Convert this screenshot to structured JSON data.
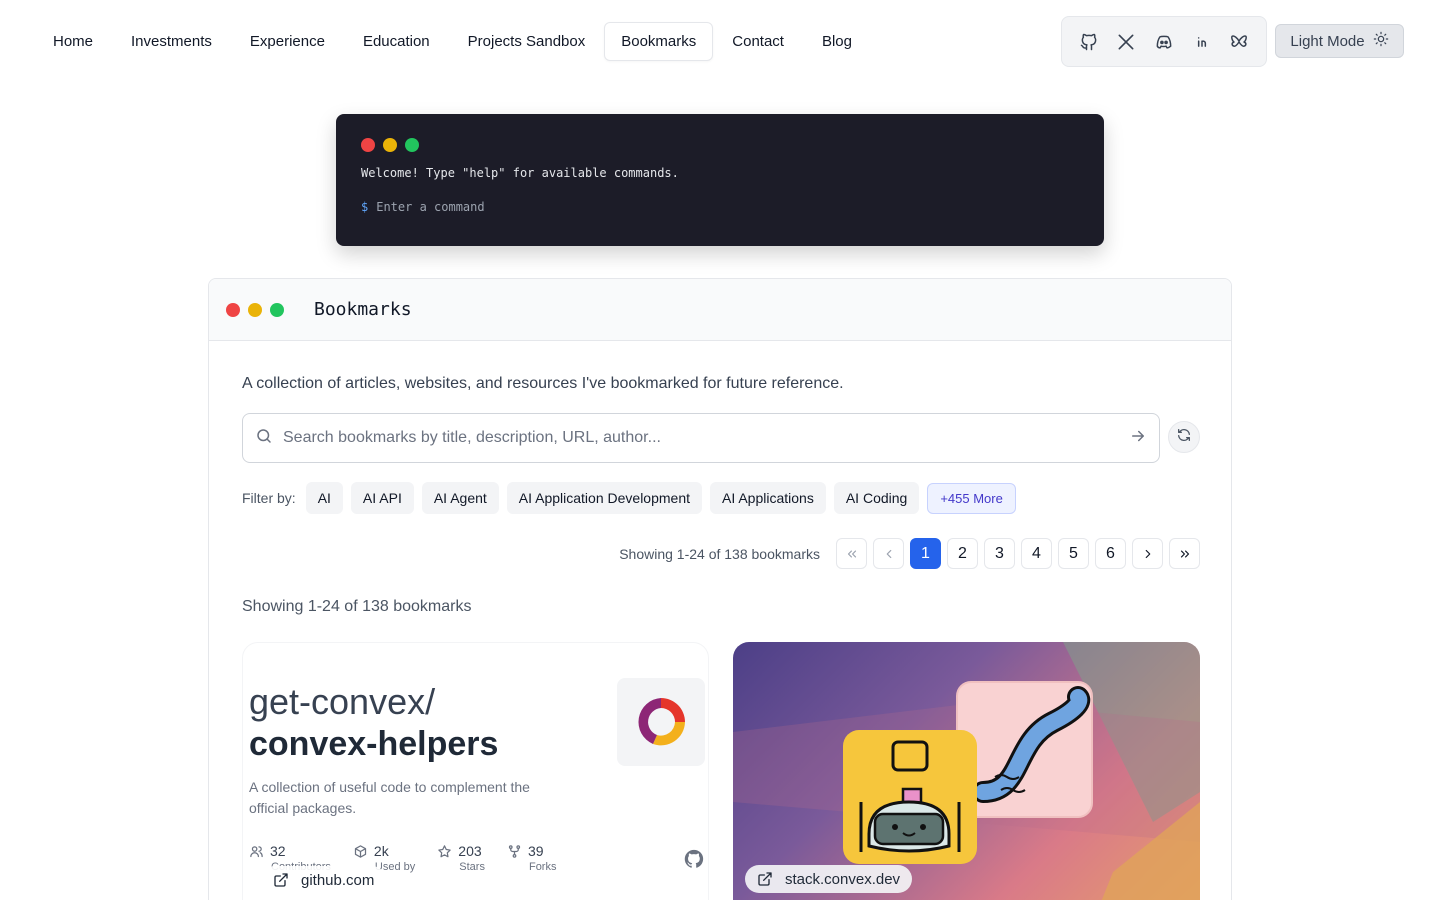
{
  "nav": {
    "items": [
      {
        "label": "Home",
        "name": "home"
      },
      {
        "label": "Investments",
        "name": "investments"
      },
      {
        "label": "Experience",
        "name": "experience"
      },
      {
        "label": "Education",
        "name": "education"
      },
      {
        "label": "Projects Sandbox",
        "name": "projects-sandbox"
      },
      {
        "label": "Bookmarks",
        "name": "bookmarks",
        "active": true
      },
      {
        "label": "Contact",
        "name": "contact"
      },
      {
        "label": "Blog",
        "name": "blog"
      }
    ],
    "social_icons": [
      "github-icon",
      "x-icon",
      "discord-icon",
      "linkedin-icon",
      "bluesky-icon"
    ],
    "theme_label": "Light Mode",
    "theme_icon": "sun-icon"
  },
  "terminal": {
    "welcome": "Welcome! Type \"help\" for available commands.",
    "prompt_symbol": "$",
    "placeholder": "Enter a command"
  },
  "panel": {
    "title": "Bookmarks",
    "description": "A collection of articles, websites, and resources I've bookmarked for future reference.",
    "search_placeholder": "Search bookmarks by title, description, URL, author...",
    "filter_label": "Filter by:",
    "filters": [
      "AI",
      "AI API",
      "AI Agent",
      "AI Application Development",
      "AI Applications",
      "AI Coding"
    ],
    "more_filters": "+455 More",
    "pagination": {
      "summary": "Showing 1-24 of 138 bookmarks",
      "pages": [
        "1",
        "2",
        "3",
        "4",
        "5",
        "6"
      ],
      "current_page": 1
    },
    "showing": "Showing 1-24 of 138 bookmarks"
  },
  "cards": [
    {
      "owner": "get-convex/",
      "repo": "convex-helpers",
      "description": "A collection of useful code to complement the official packages.",
      "stats": [
        {
          "value": "32",
          "label": "Contributors",
          "icon": "people-icon"
        },
        {
          "value": "2k",
          "label": "Used by",
          "icon": "package-icon"
        },
        {
          "value": "203",
          "label": "Stars",
          "icon": "star-icon"
        },
        {
          "value": "39",
          "label": "Forks",
          "icon": "fork-icon"
        }
      ],
      "domain": "github.com"
    },
    {
      "domain": "stack.convex.dev"
    }
  ],
  "colors": {
    "accent": "#2563eb",
    "terminal_bg": "#1c1c28",
    "dot_red": "#ef4444",
    "dot_yellow": "#eab308",
    "dot_green": "#22c55e"
  }
}
